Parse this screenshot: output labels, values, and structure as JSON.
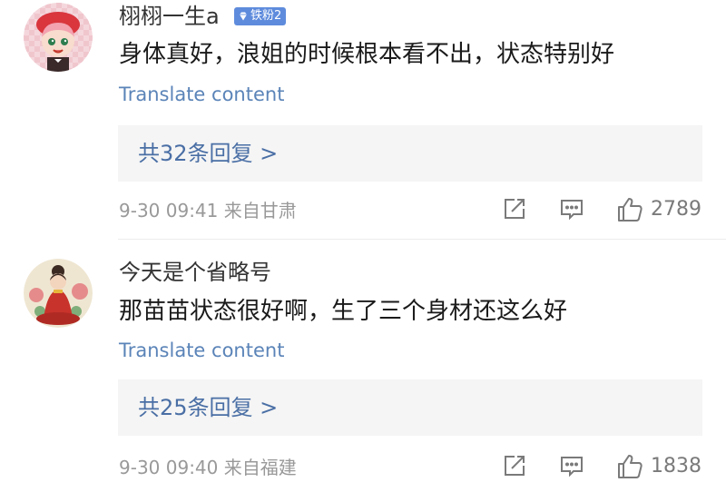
{
  "comments": [
    {
      "username": "栩栩一生a",
      "badge": {
        "icon": "diamond-icon",
        "label": "铁粉2",
        "color": "#5e8bdc"
      },
      "text": "身体真好，浪姐的时候根本看不出，状态特别好",
      "translate_label": "Translate content",
      "replies_label": "共32条回复 >",
      "timestamp": "9-30 09:41",
      "location": "来自甘肃",
      "likes": "2789"
    },
    {
      "username": "今天是个省略号",
      "text": "那苗苗状态很好啊，生了三个身材还这么好",
      "translate_label": "Translate content",
      "replies_label": "共25条回复 >",
      "timestamp": "9-30 09:40",
      "location": "来自福建",
      "likes": "1838"
    }
  ],
  "colors": {
    "link": "#5b84b8",
    "reply_text": "#4a6fa5",
    "reply_bg": "#f5f5f5",
    "meta": "#999999",
    "badge": "#5e8bdc"
  },
  "icons": [
    "share-icon",
    "comment-icon",
    "thumbs-up-icon"
  ]
}
